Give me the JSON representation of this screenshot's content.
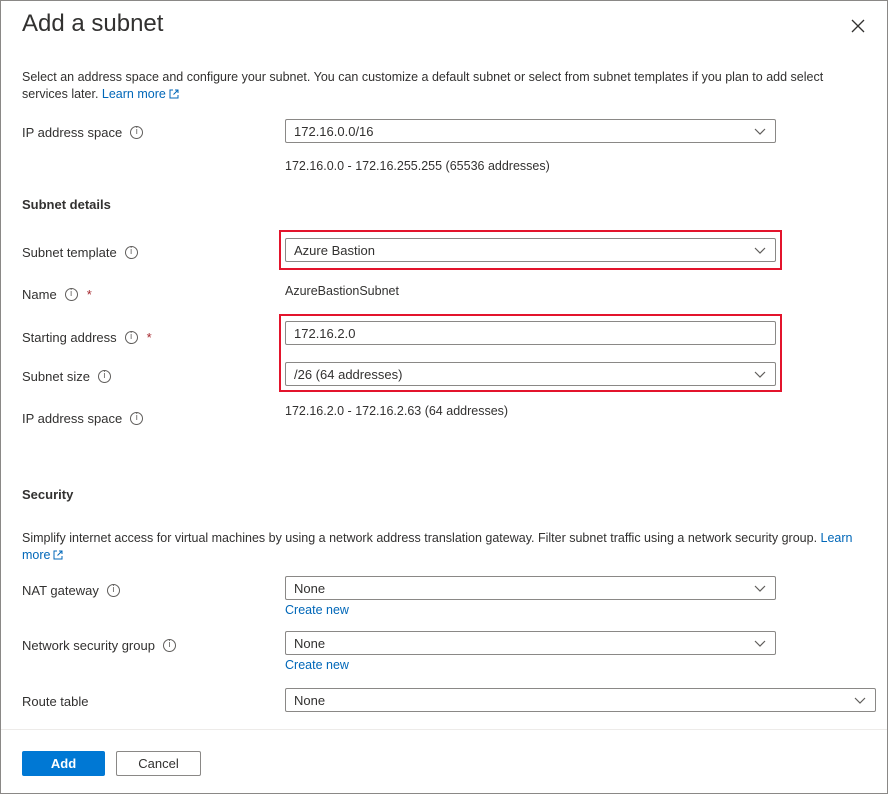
{
  "panel": {
    "title": "Add a subnet",
    "description": "Select an address space and configure your subnet. You can customize a default subnet or select from subnet templates if you plan to add select services later.",
    "learn_more": "Learn more"
  },
  "ip_address_space": {
    "label": "IP address space",
    "value": "172.16.0.0/16",
    "range": "172.16.0.0 - 172.16.255.255 (65536 addresses)"
  },
  "subnet_details": {
    "heading": "Subnet details",
    "template_label": "Subnet template",
    "template_value": "Azure Bastion",
    "name_label": "Name",
    "name_value": "AzureBastionSubnet",
    "starting_label": "Starting address",
    "starting_value": "172.16.2.0",
    "size_label": "Subnet size",
    "size_value": "/26 (64 addresses)",
    "space_label": "IP address space",
    "space_value": "172.16.2.0 - 172.16.2.63 (64 addresses)",
    "required_marker": "*"
  },
  "security": {
    "heading": "Security",
    "description": "Simplify internet access for virtual machines by using a network address translation gateway. Filter subnet traffic using a network security group.",
    "learn_more": "Learn more",
    "nat_label": "NAT gateway",
    "nat_value": "None",
    "nsg_label": "Network security group",
    "nsg_value": "None",
    "route_label": "Route table",
    "route_value": "None",
    "create_new": "Create new"
  },
  "footer": {
    "add": "Add",
    "cancel": "Cancel"
  },
  "colors": {
    "accent": "#0078d4",
    "link": "#0067b8",
    "highlight": "#e3142c"
  }
}
